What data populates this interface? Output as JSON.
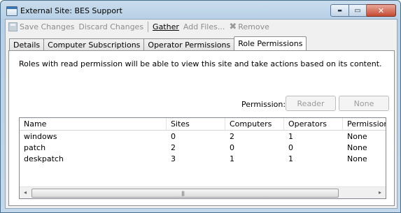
{
  "window": {
    "title": "External Site: BES Support"
  },
  "toolbar": {
    "save_changes": "Save Changes",
    "discard_changes": "Discard Changes",
    "gather": "Gather",
    "add_files": "Add Files...",
    "remove": "Remove"
  },
  "tabs": [
    {
      "label": "Details"
    },
    {
      "label": "Computer Subscriptions"
    },
    {
      "label": "Operator Permissions"
    },
    {
      "label": "Role Permissions"
    }
  ],
  "panel": {
    "description": "Roles with read permission will be able to view this site and take actions based on its content.",
    "permission_label": "Permission:",
    "reader_button": "Reader",
    "none_button": "None"
  },
  "table": {
    "columns": [
      "Name",
      "Sites",
      "Computers",
      "Operators",
      "Permission"
    ],
    "rows": [
      [
        "windows",
        "0",
        "2",
        "1",
        "None"
      ],
      [
        "patch",
        "2",
        "0",
        "0",
        "None"
      ],
      [
        "deskpatch",
        "3",
        "1",
        "1",
        "None"
      ]
    ]
  },
  "scrollbar": {
    "left_arrow": "◂",
    "right_arrow": "▸",
    "grip": "|||"
  },
  "caption": {
    "minimize": "▬",
    "maximize": "▭",
    "close": "✕"
  }
}
